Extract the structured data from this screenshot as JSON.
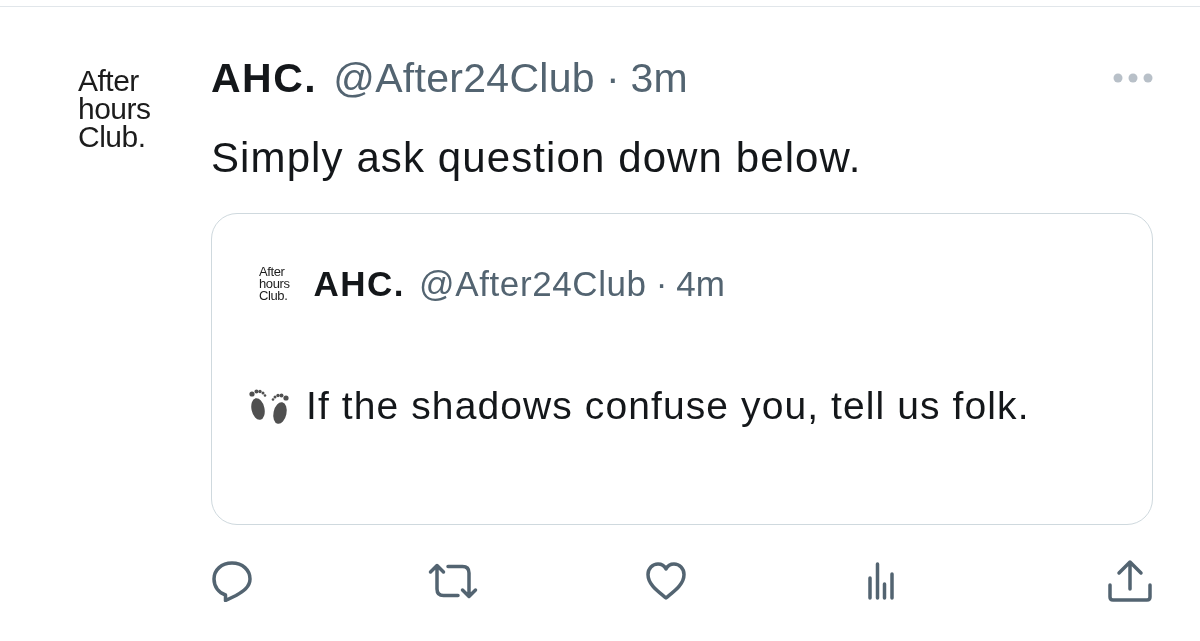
{
  "tweet": {
    "avatar_logo": [
      "After",
      "hours",
      "Club."
    ],
    "display_name": "AHC.",
    "handle": "@After24Club",
    "separator": "·",
    "time": "3m",
    "text": "Simply ask question down below.",
    "quoted_tweet": {
      "avatar_logo": [
        "After",
        "hours",
        "Club."
      ],
      "display_name": "AHC.",
      "handle": "@After24Club",
      "separator": "·",
      "time": "4m",
      "text": "If the shadows confuse you, tell us folk."
    }
  }
}
